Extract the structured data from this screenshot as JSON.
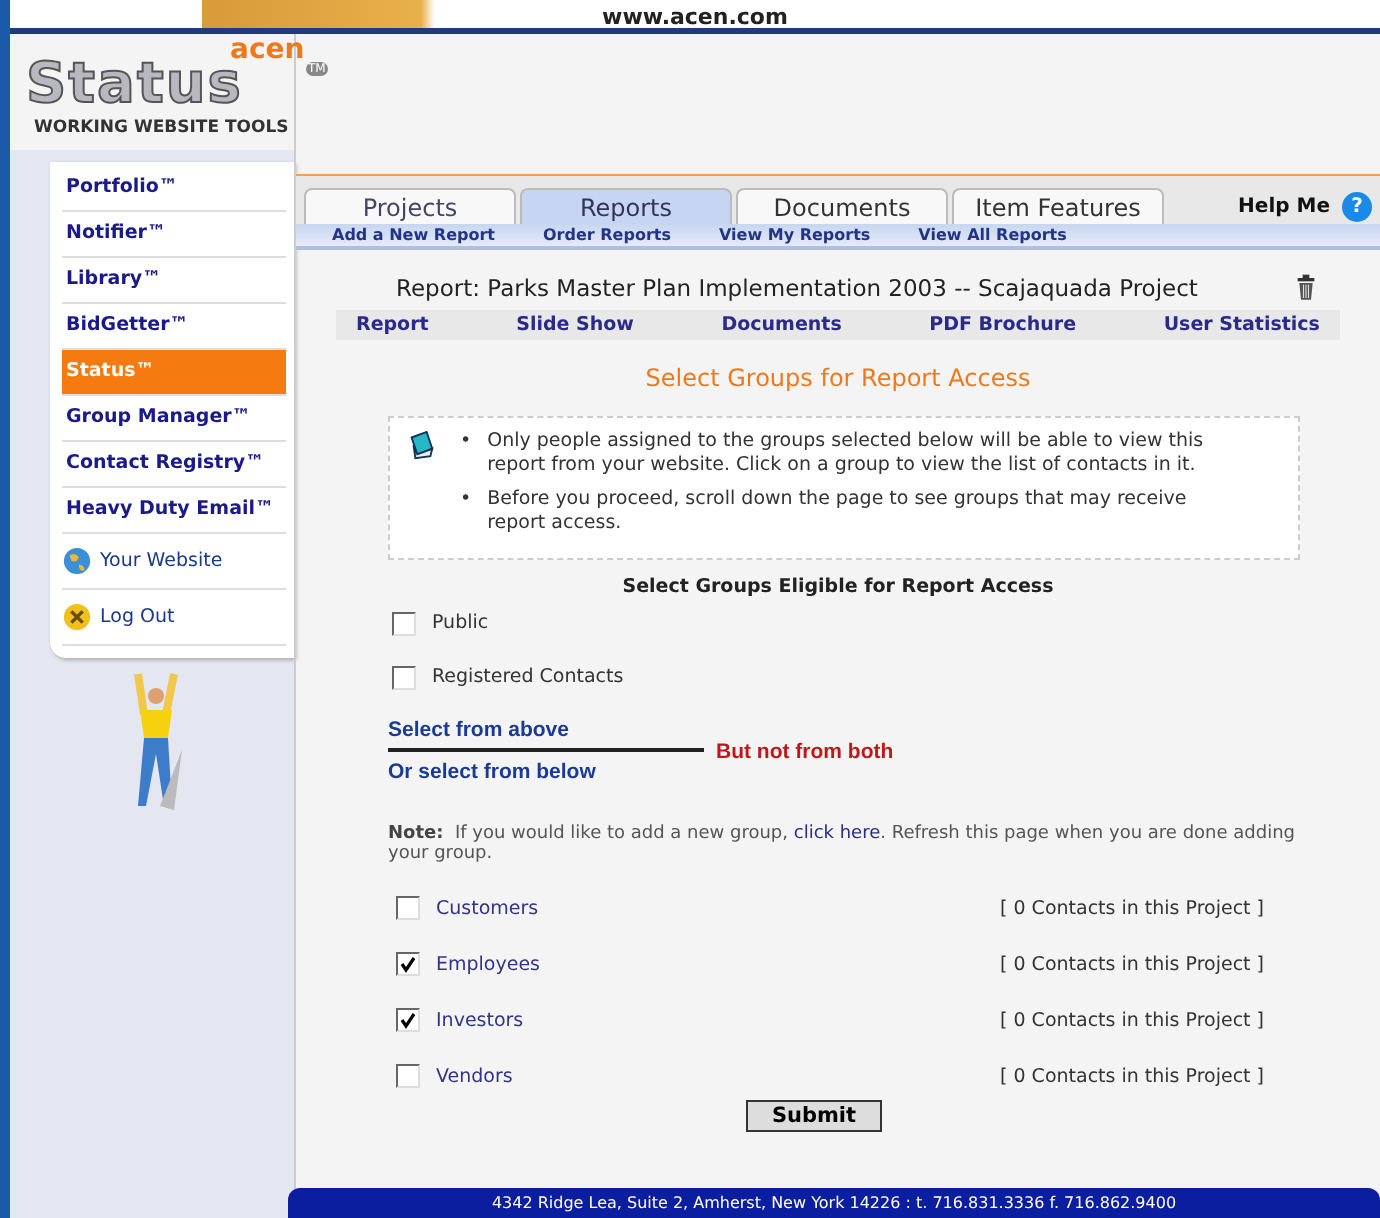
{
  "header": {
    "url": "www.acen.com"
  },
  "logo": {
    "brand": "acen",
    "name": "Status",
    "tm": "TM",
    "tagline": "WORKING WEBSITE TOOLS"
  },
  "sidebar": {
    "items": [
      {
        "label": "Portfolio™",
        "kind": "text",
        "selected": false
      },
      {
        "label": "Notifier™",
        "kind": "text",
        "selected": false
      },
      {
        "label": "Library™",
        "kind": "text",
        "selected": false
      },
      {
        "label": "BidGetter™",
        "kind": "text",
        "selected": false
      },
      {
        "label": "Status™",
        "kind": "text",
        "selected": true
      },
      {
        "label": "Group Manager™",
        "kind": "text",
        "selected": false
      },
      {
        "label": "Contact Registry™",
        "kind": "text",
        "selected": false
      },
      {
        "label": "Heavy Duty Email™",
        "kind": "text",
        "selected": false
      },
      {
        "label": "Your Website",
        "kind": "globe",
        "selected": false
      },
      {
        "label": "Log Out",
        "kind": "logout",
        "selected": false
      }
    ]
  },
  "tabs": [
    {
      "label": "Projects",
      "selected": false
    },
    {
      "label": "Reports",
      "selected": true
    },
    {
      "label": "Documents",
      "selected": false
    },
    {
      "label": "Item Features",
      "selected": false
    }
  ],
  "help": {
    "label": "Help Me",
    "icon": "?"
  },
  "subnav": [
    "Add a New Report",
    "Order Reports",
    "View My Reports",
    "View All Reports"
  ],
  "report_title": "Report: Parks Master Plan Implementation 2003 -- Scajaquada Project",
  "report_nav": [
    "Report",
    "Slide Show",
    "Documents",
    "PDF Brochure",
    "User Statistics"
  ],
  "section_title": "Select Groups for Report Access",
  "info_bullet": "•",
  "info_bullets": [
    "Only people assigned to the groups selected below will be able to view this report from your website. Click on a group to view the list of contacts in it.",
    "Before you proceed, scroll down the page to see groups that may receive report access."
  ],
  "groups_heading": "Select Groups Eligible for Report Access",
  "top_groups": [
    {
      "label": "Public",
      "checked": false
    },
    {
      "label": "Registered Contacts",
      "checked": false
    }
  ],
  "divider": {
    "above": "Select from above",
    "below": "Or select from below",
    "warning": "But not from both"
  },
  "note": {
    "label": "Note:",
    "before": "If you would like to add a new group,",
    "link": "click here",
    "after": ". Refresh this page when you are done adding your group."
  },
  "groups": [
    {
      "label": "Customers",
      "checked": false,
      "count": "[ 0 Contacts in this Project ]"
    },
    {
      "label": "Employees",
      "checked": true,
      "count": "[ 0 Contacts in this Project ]"
    },
    {
      "label": "Investors",
      "checked": true,
      "count": "[ 0 Contacts in this Project ]"
    },
    {
      "label": "Vendors",
      "checked": false,
      "count": "[ 0 Contacts in this Project ]"
    }
  ],
  "submit": "Submit",
  "footer": "4342 Ridge Lea, Suite 2, Amherst, New York 14226 : t. 716.831.3336 f. 716.862.9400"
}
